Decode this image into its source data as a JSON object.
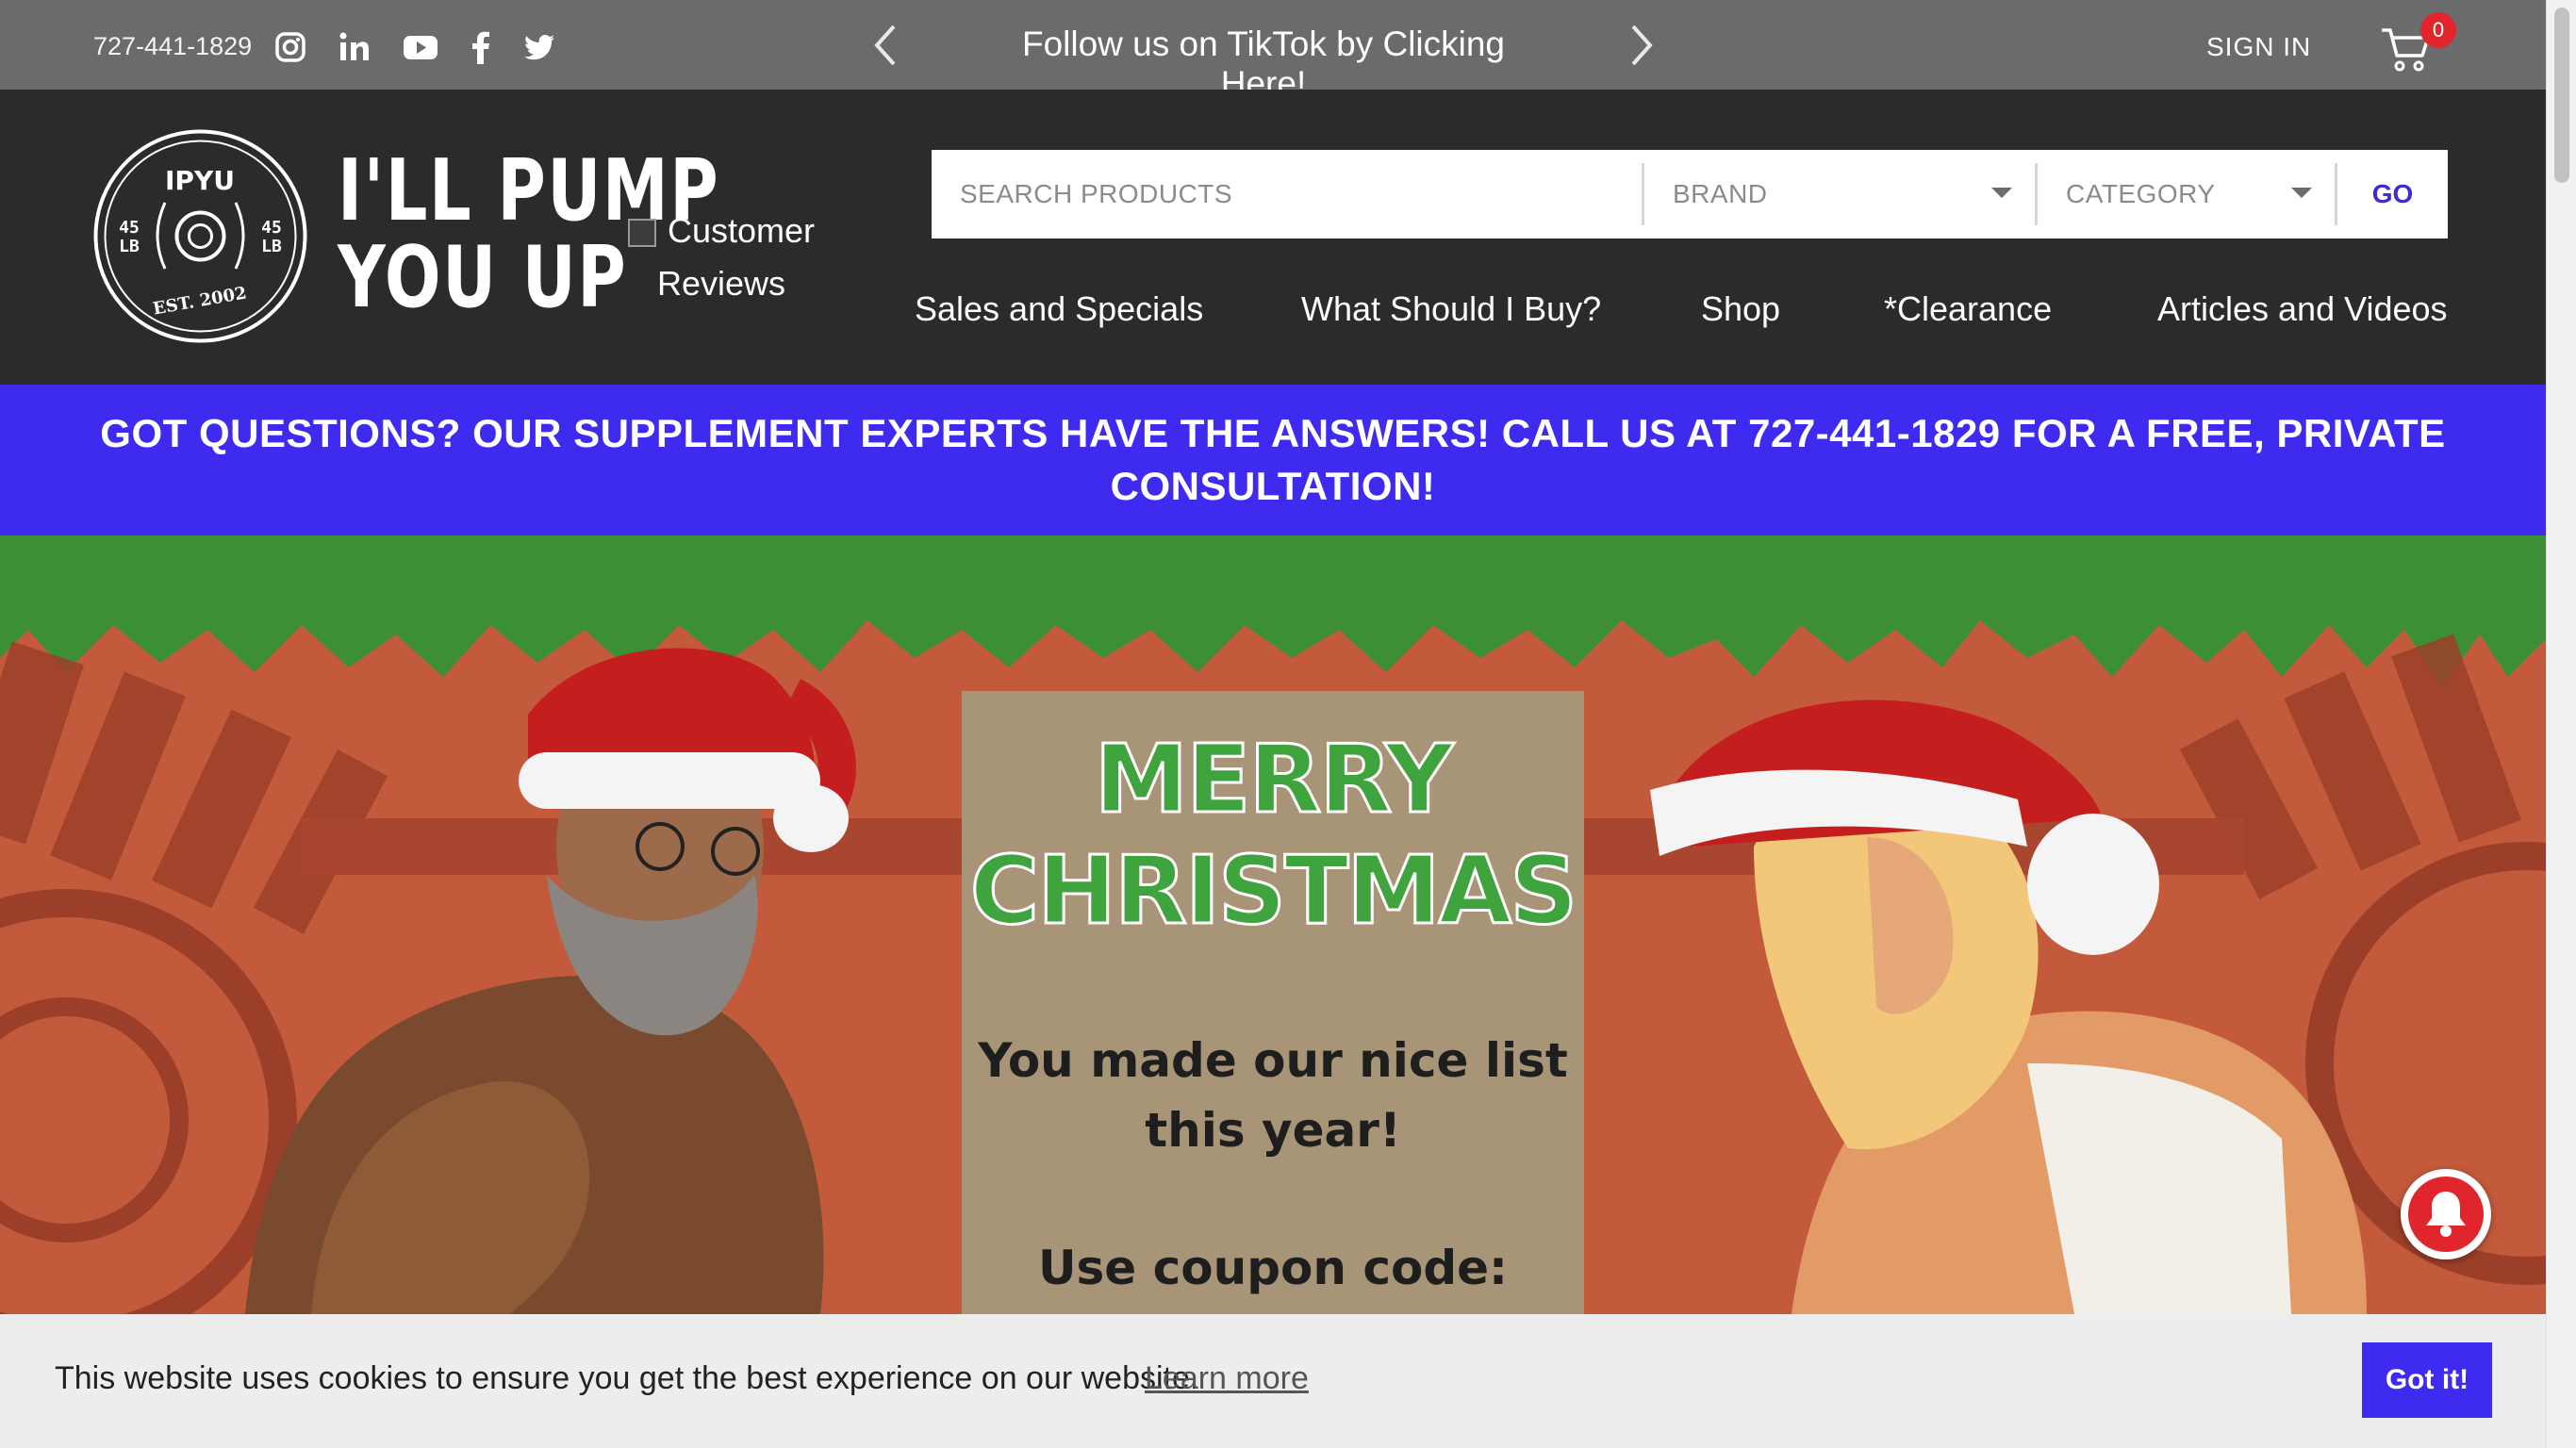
{
  "topbar": {
    "phone": "727-441-1829",
    "social": [
      "instagram-icon",
      "linkedin-icon",
      "youtube-icon",
      "facebook-icon",
      "twitter-icon"
    ],
    "promo": "Follow us on TikTok by Clicking Here!",
    "sign_in": "SIGN IN",
    "cart_count": "0"
  },
  "header": {
    "logo_badge": {
      "top": "IPYU",
      "left_weight": "45",
      "right_weight": "45",
      "unit": "LB",
      "bottom": "EST. 2002"
    },
    "logo_line1": "I'LL PUMP",
    "logo_line2": "YOU UP",
    "reviews_line1": "Customer",
    "reviews_line2": "Reviews"
  },
  "search": {
    "placeholder": "SEARCH PRODUCTS",
    "brand": "BRAND",
    "category": "CATEGORY",
    "go": "GO"
  },
  "nav": [
    "Sales and Specials",
    "What Should I Buy?",
    "Shop",
    "*Clearance",
    "Articles and Videos"
  ],
  "banner": {
    "line1": "GOT QUESTIONS? OUR SUPPLEMENT EXPERTS HAVE THE ANSWERS! CALL US AT 727-441-1829 FOR A FREE, PRIVATE",
    "line2": "CONSULTATION!"
  },
  "hero": {
    "title1": "MERRY",
    "title2": "CHRISTMAS",
    "line1": "You made our nice list",
    "line2": "this year!",
    "line3": "Use coupon code:"
  },
  "cookie": {
    "message": "This website uses cookies to ensure you get the best experience on our website.",
    "learn_more": "Learn more",
    "got_it": "Got it!"
  },
  "colors": {
    "topbar": "#6b6b6b",
    "header": "#2b2b2b",
    "accent": "#3f2bf0",
    "hero_bg": "#c45a3c",
    "hero_green": "#3d8f36",
    "badge_red": "#e0252c"
  }
}
